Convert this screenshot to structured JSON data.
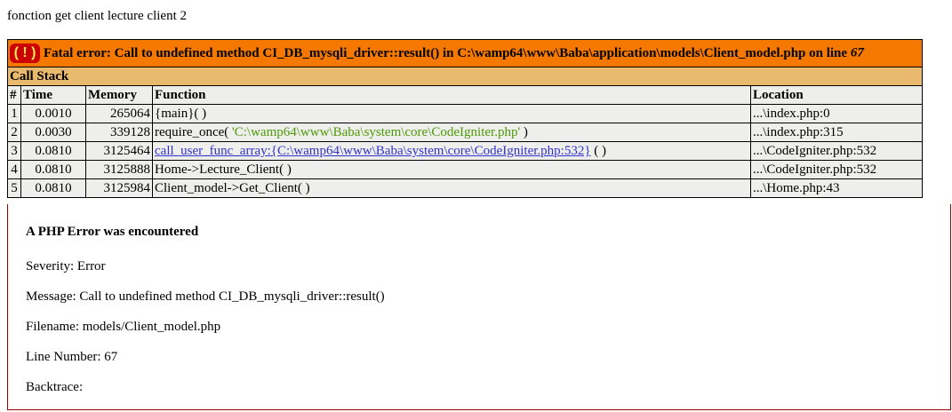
{
  "intro_text": "fonction get client lecture client 2",
  "xdebug": {
    "icon_glyph": "( ! )",
    "fatal_message": "Fatal error: Call to undefined method CI_DB_mysqli_driver::result() in C:\\wamp64\\www\\Baba\\application\\models\\Client_model.php on line ",
    "fatal_line": "67",
    "call_stack_title": "Call Stack",
    "headers": {
      "num": "#",
      "time": "Time",
      "memory": "Memory",
      "function": "Function",
      "location": "Location"
    },
    "rows": [
      {
        "num": "1",
        "time": "0.0010",
        "memory": "265064",
        "func_pre": "{main}( )",
        "func_link": "",
        "func_str": "",
        "func_post": "",
        "location": "...\\index.php:0"
      },
      {
        "num": "2",
        "time": "0.0030",
        "memory": "339128",
        "func_pre": "require_once( ",
        "func_link": "",
        "func_str": "'C:\\wamp64\\www\\Baba\\system\\core\\CodeIgniter.php'",
        "func_post": " )",
        "location": "...\\index.php:315"
      },
      {
        "num": "3",
        "time": "0.0810",
        "memory": "3125464",
        "func_pre": "",
        "func_link": "call_user_func_array:{C:\\wamp64\\www\\Baba\\system\\core\\CodeIgniter.php:532}",
        "func_str": "",
        "func_post": " ( )",
        "location": "...\\CodeIgniter.php:532"
      },
      {
        "num": "4",
        "time": "0.0810",
        "memory": "3125888",
        "func_pre": "Home->Lecture_Client( )",
        "func_link": "",
        "func_str": "",
        "func_post": "",
        "location": "...\\CodeIgniter.php:532"
      },
      {
        "num": "5",
        "time": "0.0810",
        "memory": "3125984",
        "func_pre": "Client_model->Get_Client( )",
        "func_link": "",
        "func_str": "",
        "func_post": "",
        "location": "...\\Home.php:43"
      }
    ]
  },
  "ci_error": {
    "heading": "A PHP Error was encountered",
    "severity": "Severity: Error",
    "message": "Message: Call to undefined method CI_DB_mysqli_driver::result()",
    "filename": "Filename: models/Client_model.php",
    "line_number": "Line Number: 67",
    "backtrace": "Backtrace:"
  },
  "colors": {
    "fatal_bg": "#f57900",
    "stack_bg": "#e9b96e",
    "cell_bg": "#eeeeec",
    "icon_bg": "#cc0000",
    "icon_fg": "#fce94f",
    "string_green": "#4e9a06",
    "link_blue": "#3333cc",
    "ci_border": "#990000"
  }
}
